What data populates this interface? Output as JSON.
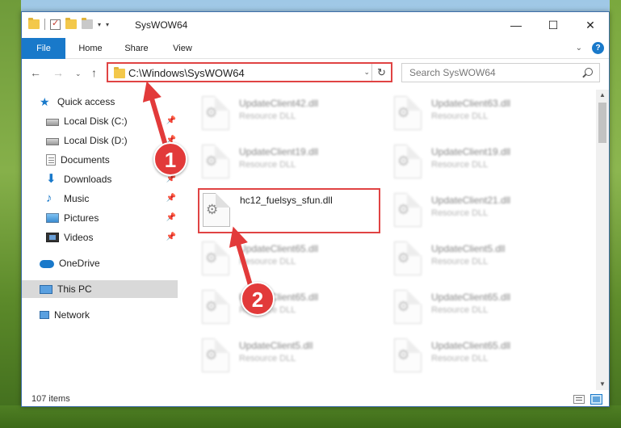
{
  "window": {
    "title": "SysWOW64",
    "minimize": "—",
    "maximize": "☐",
    "close": "✕"
  },
  "ribbon": {
    "tabs": [
      "File",
      "Home",
      "Share",
      "View"
    ],
    "help": "?"
  },
  "nav": {
    "back": "←",
    "forward": "→",
    "recent": "⌄",
    "up": "↑",
    "address": "C:\\Windows\\SysWOW64",
    "dropdown": "⌄",
    "refresh": "↻",
    "search_placeholder": "Search SysWOW64"
  },
  "sidebar": {
    "items": [
      {
        "label": "Quick access",
        "icon": "star-icon"
      },
      {
        "label": "Local Disk (C:)",
        "icon": "drive-icon",
        "pinned": true
      },
      {
        "label": "Local Disk (D:)",
        "icon": "drive-icon",
        "pinned": true
      },
      {
        "label": "Documents",
        "icon": "documents-icon",
        "pinned": true
      },
      {
        "label": "Downloads",
        "icon": "download-icon",
        "pinned": true
      },
      {
        "label": "Music",
        "icon": "music-icon",
        "pinned": true
      },
      {
        "label": "Pictures",
        "icon": "pictures-icon",
        "pinned": true
      },
      {
        "label": "Videos",
        "icon": "videos-icon",
        "pinned": true
      },
      {
        "label": "OneDrive",
        "icon": "cloud-icon"
      },
      {
        "label": "This PC",
        "icon": "pc-icon",
        "selected": true
      },
      {
        "label": "Network",
        "icon": "network-icon"
      }
    ],
    "pin_glyph": "📌"
  },
  "files": [
    {
      "name": "UpdateClient42.dll",
      "type": "Resource DLL"
    },
    {
      "name": "UpdateClient63.dll",
      "type": "Resource DLL"
    },
    {
      "name": "UpdateClient19.dll",
      "type": "Resource DLL"
    },
    {
      "name": "UpdateClient19.dll",
      "type": "Resource DLL"
    },
    {
      "name": "hc12_fuelsys_sfun.dll",
      "type": ""
    },
    {
      "name": "UpdateClient21.dll",
      "type": "Resource DLL"
    },
    {
      "name": "UpdateClient65.dll",
      "type": "Resource DLL"
    },
    {
      "name": "UpdateClient5.dll",
      "type": "Resource DLL"
    },
    {
      "name": "UpdateClient65.dll",
      "type": "Resource DLL"
    },
    {
      "name": "UpdateClient65.dll",
      "type": "Resource DLL"
    },
    {
      "name": "UpdateClient5.dll",
      "type": "Resource DLL"
    },
    {
      "name": "UpdateClient65.dll",
      "type": "Resource DLL"
    }
  ],
  "status": {
    "count": "107 items"
  },
  "annotations": {
    "step1": "1",
    "step2": "2",
    "color": "#e23a3a"
  }
}
